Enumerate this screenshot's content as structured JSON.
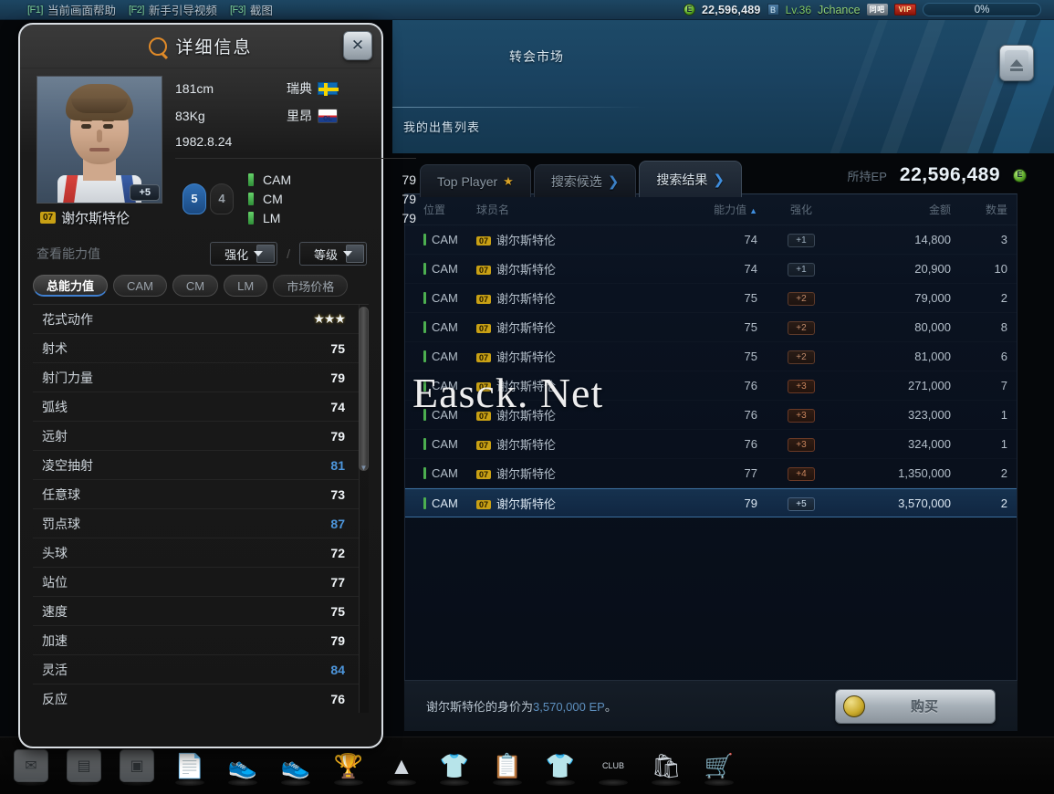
{
  "topbar": {
    "hotkeys": [
      {
        "key": "[F1]",
        "label": "当前画面帮助"
      },
      {
        "key": "[F2]",
        "label": "新手引导视频"
      },
      {
        "key": "[F3]",
        "label": "截图"
      }
    ],
    "currency_icon": "coin-icon",
    "money": "22,596,489",
    "level_icon": "blue-square-icon",
    "level": "Lv.36",
    "username": "Jchance",
    "badge_1": "同吧",
    "badge_2": "VIP",
    "progress": "0%"
  },
  "market": {
    "title": "转会市场",
    "my_sale_list": "我的出售列表",
    "eject_icon": "eject-icon",
    "tabs": [
      {
        "label": "Top Player",
        "icon": "star-icon",
        "active": false
      },
      {
        "label": "搜索候选",
        "icon": "chevron-right-icon",
        "active": false
      },
      {
        "label": "搜索结果",
        "icon": "chevron-right-icon",
        "active": true
      }
    ],
    "ep_label": "所持EP",
    "ep_value": "22,596,489",
    "ep_icon": "coin-icon",
    "columns": [
      "位置",
      "球员名",
      "能力值",
      "强化",
      "金额",
      "数量"
    ],
    "sort_column": "能力值",
    "sort_direction": "▲",
    "rows": [
      {
        "pos": "CAM",
        "num": "07",
        "name": "谢尔斯特伦",
        "ovr": "74",
        "enh": "+1",
        "enh_tier": "t1",
        "price": "14,800",
        "qty": "3",
        "selected": false
      },
      {
        "pos": "CAM",
        "num": "07",
        "name": "谢尔斯特伦",
        "ovr": "74",
        "enh": "+1",
        "enh_tier": "t1",
        "price": "20,900",
        "qty": "10",
        "selected": false
      },
      {
        "pos": "CAM",
        "num": "07",
        "name": "谢尔斯特伦",
        "ovr": "75",
        "enh": "+2",
        "enh_tier": "t2",
        "price": "79,000",
        "qty": "2",
        "selected": false
      },
      {
        "pos": "CAM",
        "num": "07",
        "name": "谢尔斯特伦",
        "ovr": "75",
        "enh": "+2",
        "enh_tier": "t2",
        "price": "80,000",
        "qty": "8",
        "selected": false
      },
      {
        "pos": "CAM",
        "num": "07",
        "name": "谢尔斯特伦",
        "ovr": "75",
        "enh": "+2",
        "enh_tier": "t2",
        "price": "81,000",
        "qty": "6",
        "selected": false
      },
      {
        "pos": "CAM",
        "num": "07",
        "name": "谢尔斯特伦",
        "ovr": "76",
        "enh": "+3",
        "enh_tier": "t3",
        "price": "271,000",
        "qty": "7",
        "selected": false
      },
      {
        "pos": "CAM",
        "num": "07",
        "name": "谢尔斯特伦",
        "ovr": "76",
        "enh": "+3",
        "enh_tier": "t3",
        "price": "323,000",
        "qty": "1",
        "selected": false
      },
      {
        "pos": "CAM",
        "num": "07",
        "name": "谢尔斯特伦",
        "ovr": "76",
        "enh": "+3",
        "enh_tier": "t3",
        "price": "324,000",
        "qty": "1",
        "selected": false
      },
      {
        "pos": "CAM",
        "num": "07",
        "name": "谢尔斯特伦",
        "ovr": "77",
        "enh": "+4",
        "enh_tier": "t3",
        "price": "1,350,000",
        "qty": "2",
        "selected": false
      },
      {
        "pos": "CAM",
        "num": "07",
        "name": "谢尔斯特伦",
        "ovr": "79",
        "enh": "+5",
        "enh_tier": "t5",
        "price": "3,570,000",
        "qty": "2",
        "selected": true
      }
    ],
    "status_prefix": "谢尔斯特伦的身价为",
    "status_amount": "3,570,000 EP",
    "status_suffix": "。",
    "buy_label": "购买",
    "buy_coin_icon": "gold-coin-icon"
  },
  "watermark": "Easck. Net",
  "dialog": {
    "title": "详细信息",
    "search_icon": "magnifier-icon",
    "close_label": "✕",
    "player": {
      "number": "07",
      "name": "谢尔斯特伦",
      "enhance_badge": "+5",
      "height": "181cm",
      "weight": "83Kg",
      "birthday": "1982.8.24",
      "nation": "瑞典",
      "nation_flag": "sweden-flag-icon",
      "club": "里昂",
      "club_crest": "lyon-crest-icon",
      "foot_strong": "5",
      "foot_weak": "4",
      "positions": [
        {
          "pos": "CAM",
          "rating": "79"
        },
        {
          "pos": "CM",
          "rating": "79"
        },
        {
          "pos": "LM",
          "rating": "79"
        }
      ]
    },
    "view_label": "查看能力值",
    "select_enhance": "强化",
    "select_level": "等级",
    "separator": "/",
    "sub_tabs": [
      {
        "label": "总能力值",
        "active": true,
        "dark": false
      },
      {
        "label": "CAM",
        "active": false,
        "dark": false
      },
      {
        "label": "CM",
        "active": false,
        "dark": false
      },
      {
        "label": "LM",
        "active": false,
        "dark": false
      },
      {
        "label": "市场价格",
        "active": false,
        "dark": true
      }
    ],
    "stats": [
      {
        "label": "花式动作",
        "value": "★★★",
        "stars": true,
        "highlight": false
      },
      {
        "label": "射术",
        "value": "75",
        "stars": false,
        "highlight": false
      },
      {
        "label": "射门力量",
        "value": "79",
        "stars": false,
        "highlight": false
      },
      {
        "label": "弧线",
        "value": "74",
        "stars": false,
        "highlight": false
      },
      {
        "label": "远射",
        "value": "79",
        "stars": false,
        "highlight": false
      },
      {
        "label": "凌空抽射",
        "value": "81",
        "stars": false,
        "highlight": true
      },
      {
        "label": "任意球",
        "value": "73",
        "stars": false,
        "highlight": false
      },
      {
        "label": "罚点球",
        "value": "87",
        "stars": false,
        "highlight": true
      },
      {
        "label": "头球",
        "value": "72",
        "stars": false,
        "highlight": false
      },
      {
        "label": "站位",
        "value": "77",
        "stars": false,
        "highlight": false
      },
      {
        "label": "速度",
        "value": "75",
        "stars": false,
        "highlight": false
      },
      {
        "label": "加速",
        "value": "79",
        "stars": false,
        "highlight": false
      },
      {
        "label": "灵活",
        "value": "84",
        "stars": false,
        "highlight": true
      },
      {
        "label": "反应",
        "value": "76",
        "stars": false,
        "highlight": false
      }
    ]
  },
  "dock": {
    "items": [
      {
        "icon": "mail-icon",
        "glyph": "✉",
        "faded": true
      },
      {
        "icon": "news-icon",
        "glyph": "▤",
        "faded": true
      },
      {
        "icon": "inbox-icon",
        "glyph": "▣",
        "faded": true
      },
      {
        "icon": "contract-icon",
        "glyph": "📄",
        "faded": false
      },
      {
        "icon": "boots-red-icon",
        "glyph": "👟",
        "faded": false
      },
      {
        "icon": "boots-blue-icon",
        "glyph": "👟",
        "faded": false
      },
      {
        "icon": "trophy-icon",
        "glyph": "🏆",
        "faded": false
      },
      {
        "icon": "training-cone-icon",
        "glyph": "▲",
        "faded": false
      },
      {
        "icon": "jersey-icon",
        "glyph": "👕",
        "faded": false
      },
      {
        "icon": "document-icon",
        "glyph": "📋",
        "faded": false
      },
      {
        "icon": "gold-shirt-icon",
        "glyph": "👕",
        "faded": false
      },
      {
        "icon": "club-icon",
        "glyph": "CLUB",
        "faded": false
      },
      {
        "icon": "shop-icon",
        "glyph": "🛍",
        "faded": false
      },
      {
        "icon": "cart-icon",
        "glyph": "🛒",
        "faded": false
      }
    ]
  },
  "colors": {
    "accent_blue": "#3f8ede",
    "green_pos": "#4caf50",
    "gold": "#c8a014",
    "header_blue": "#1d4a68"
  }
}
